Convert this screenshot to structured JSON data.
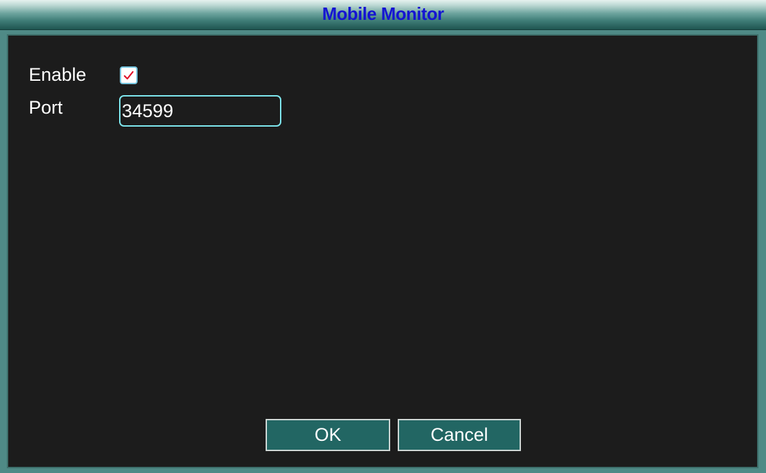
{
  "dialog": {
    "title": "Mobile Monitor"
  },
  "form": {
    "enable_label": "Enable",
    "enable_checked": true,
    "port_label": "Port",
    "port_value": "34599"
  },
  "buttons": {
    "ok_label": "OK",
    "cancel_label": "Cancel"
  },
  "colors": {
    "title_text": "#1414d2",
    "panel_bg": "#1c1c1c",
    "frame": "#4f8a86",
    "button_bg": "#226663",
    "input_border": "#7fe8ef",
    "check_mark": "#e0102a"
  }
}
